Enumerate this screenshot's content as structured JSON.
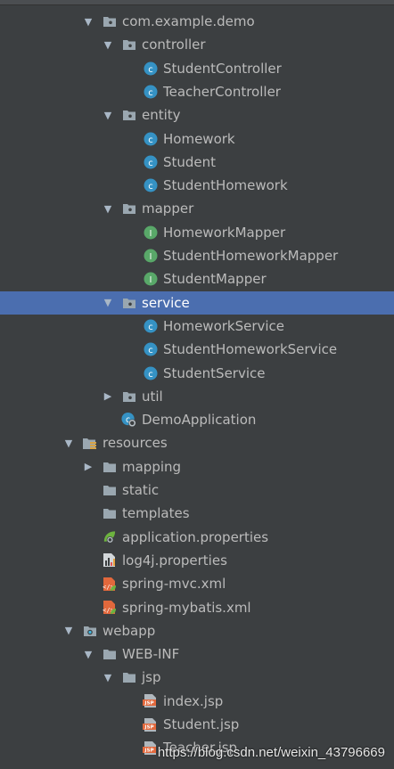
{
  "tree": [
    {
      "label": "com.example.demo",
      "icon": "package-icon",
      "arrow": "expanded"
    },
    {
      "label": "controller",
      "icon": "package-icon",
      "arrow": "expanded"
    },
    {
      "label": "StudentController",
      "icon": "class-icon"
    },
    {
      "label": "TeacherController",
      "icon": "class-icon"
    },
    {
      "label": "entity",
      "icon": "package-icon",
      "arrow": "expanded"
    },
    {
      "label": "Homework",
      "icon": "class-icon"
    },
    {
      "label": "Student",
      "icon": "class-icon"
    },
    {
      "label": "StudentHomework",
      "icon": "class-icon"
    },
    {
      "label": "mapper",
      "icon": "package-icon",
      "arrow": "expanded"
    },
    {
      "label": "HomeworkMapper",
      "icon": "interface-icon"
    },
    {
      "label": "StudentHomeworkMapper",
      "icon": "interface-icon"
    },
    {
      "label": "StudentMapper",
      "icon": "interface-icon"
    },
    {
      "label": "service",
      "icon": "package-icon",
      "arrow": "expanded",
      "selected": true
    },
    {
      "label": "HomeworkService",
      "icon": "class-icon"
    },
    {
      "label": "StudentHomeworkService",
      "icon": "class-icon"
    },
    {
      "label": "StudentService",
      "icon": "class-icon"
    },
    {
      "label": "util",
      "icon": "package-icon",
      "arrow": "collapsed"
    },
    {
      "label": "DemoApplication",
      "icon": "spring-boot-class-icon"
    },
    {
      "label": "resources",
      "icon": "resources-folder-icon",
      "arrow": "expanded"
    },
    {
      "label": "mapping",
      "icon": "folder-icon",
      "arrow": "collapsed"
    },
    {
      "label": "static",
      "icon": "folder-icon"
    },
    {
      "label": "templates",
      "icon": "folder-icon"
    },
    {
      "label": "application.properties",
      "icon": "spring-properties-icon"
    },
    {
      "label": "log4j.properties",
      "icon": "properties-file-icon"
    },
    {
      "label": "spring-mvc.xml",
      "icon": "spring-xml-icon"
    },
    {
      "label": "spring-mybatis.xml",
      "icon": "spring-xml-icon"
    },
    {
      "label": "webapp",
      "icon": "web-folder-icon",
      "arrow": "expanded"
    },
    {
      "label": "WEB-INF",
      "icon": "folder-icon",
      "arrow": "expanded"
    },
    {
      "label": "jsp",
      "icon": "folder-icon",
      "arrow": "expanded"
    },
    {
      "label": "index.jsp",
      "icon": "jsp-file-icon"
    },
    {
      "label": "Student.jsp",
      "icon": "jsp-file-icon"
    },
    {
      "label": "Teacher.jsp",
      "icon": "jsp-file-icon"
    }
  ],
  "watermark": "https://blog.csdn.net/weixin_43796669",
  "colors": {
    "background": "#3c3f41",
    "selection": "#4b6eaf",
    "text": "#bbbbbb",
    "class_icon": "#3592c4",
    "interface_icon": "#59a869",
    "jsp_icon": "#e2683c"
  }
}
